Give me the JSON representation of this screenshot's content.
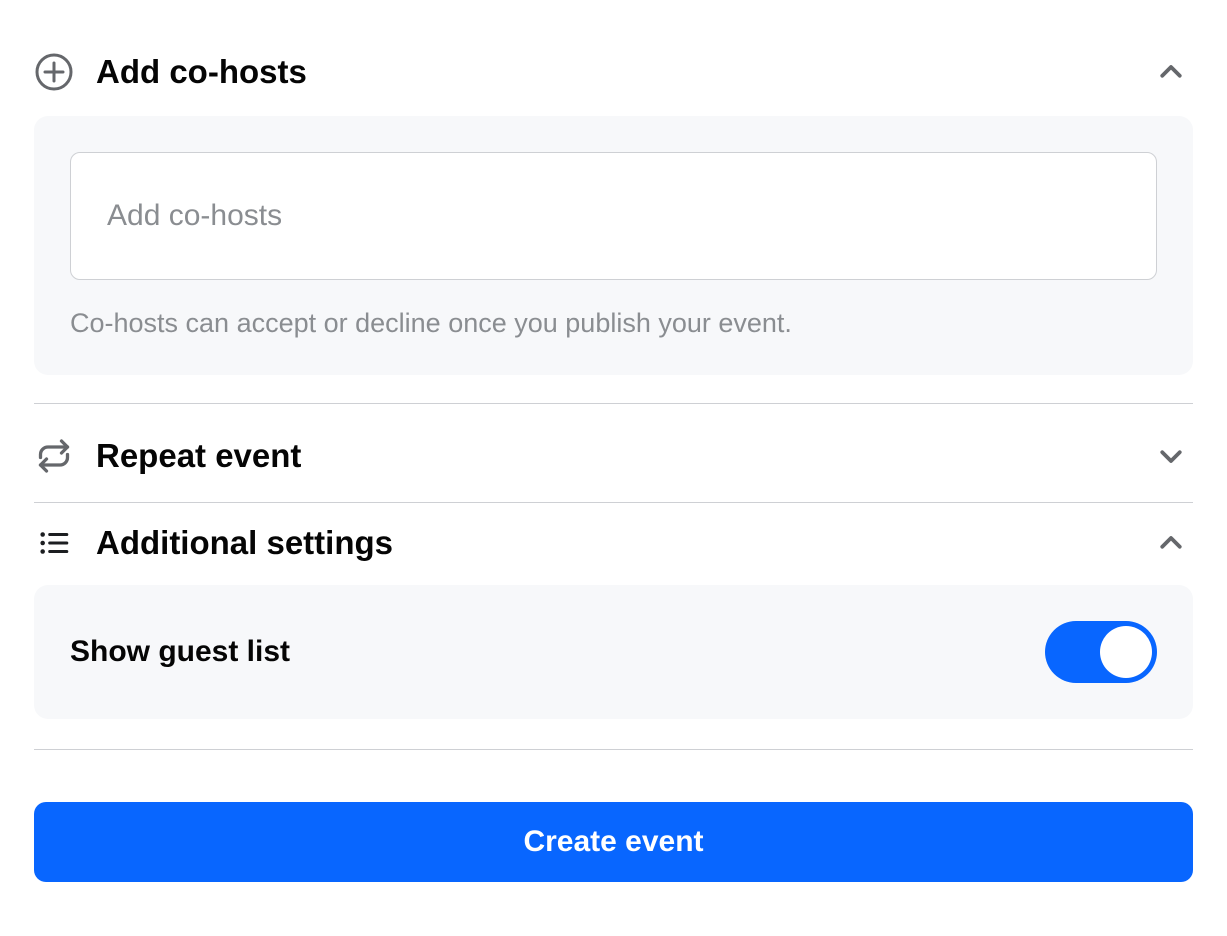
{
  "sections": {
    "cohosts": {
      "title": "Add co-hosts",
      "input_placeholder": "Add co-hosts",
      "helper_text": "Co-hosts can accept or decline once you publish your event.",
      "expanded": true
    },
    "repeat": {
      "title": "Repeat event",
      "expanded": false
    },
    "additional": {
      "title": "Additional settings",
      "expanded": true,
      "show_guest_list": {
        "label": "Show guest list",
        "value": true
      }
    }
  },
  "actions": {
    "create_event": "Create event"
  }
}
